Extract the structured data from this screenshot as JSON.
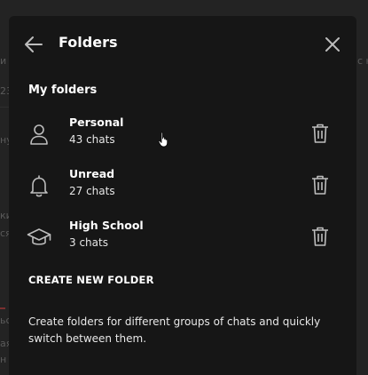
{
  "dialog": {
    "title": "Folders",
    "section_title": "My folders",
    "folders": [
      {
        "name": "Personal",
        "count": "43 chats",
        "icon": "person-icon"
      },
      {
        "name": "Unread",
        "count": "27 chats",
        "icon": "bell-icon"
      },
      {
        "name": "High School",
        "count": "3 chats",
        "icon": "graduation-cap-icon"
      }
    ],
    "create_label": "CREATE NEW FOLDER",
    "description": "Create folders for different groups of chats and quickly switch between them."
  },
  "background": {
    "fragments": [
      "и д",
      "с н",
      "23",
      "ну",
      "ки",
      "ся",
      "ьс",
      "ая",
      "н"
    ]
  },
  "colors": {
    "dialog_bg": "#161616",
    "page_bg": "#232323",
    "text": "#ffffff",
    "icon": "#bdbdbd"
  }
}
